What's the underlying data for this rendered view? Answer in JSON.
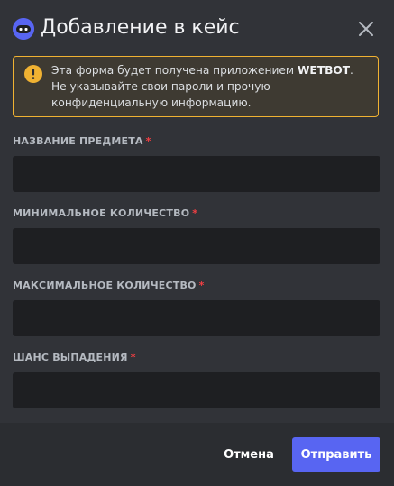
{
  "colors": {
    "background": "#313338",
    "footer": "#2b2d31",
    "input": "#1e1f22",
    "accent": "#5865f2",
    "warning": "#f0b232",
    "required": "#f23f43"
  },
  "header": {
    "app_icon": "discord-bot-icon",
    "title": "Добавление в кейс",
    "close_icon": "close-icon"
  },
  "warning": {
    "icon": "exclamation-icon",
    "text_before": "Эта форма будет получена приложением ",
    "app_name": "WETBOT",
    "text_after": ". Не указывайте свои пароли и прочую конфиденциальную информацию."
  },
  "fields": [
    {
      "label": "НАЗВАНИЕ ПРЕДМЕТА",
      "required_mark": "*",
      "value": ""
    },
    {
      "label": "МИНИМАЛЬНОЕ КОЛИЧЕСТВО",
      "required_mark": "*",
      "value": ""
    },
    {
      "label": "МАКСИМАЛЬНОЕ КОЛИЧЕСТВО",
      "required_mark": "*",
      "value": ""
    },
    {
      "label": "ШАНС ВЫПАДЕНИЯ",
      "required_mark": "*",
      "value": ""
    }
  ],
  "footer": {
    "cancel_label": "Отмена",
    "submit_label": "Отправить"
  }
}
